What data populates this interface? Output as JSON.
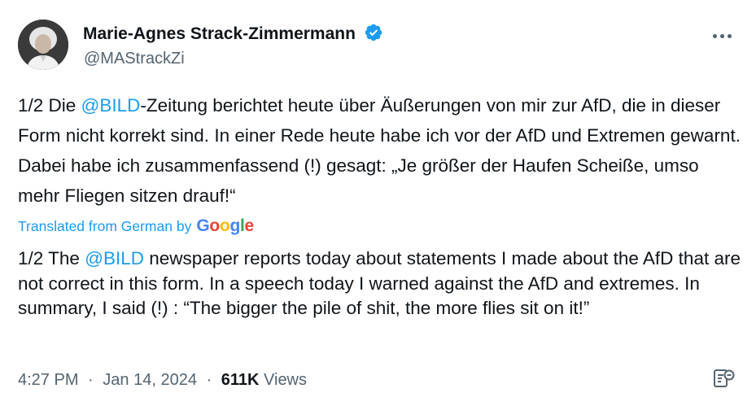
{
  "author": {
    "name": "Marie-Agnes Strack-Zimmermann",
    "handle": "@MAStrackZi",
    "verified": true
  },
  "tweet": {
    "original": {
      "part1": "1/2 Die ",
      "mention": "@BILD",
      "part2": "-Zeitung berichtet heute über Äußerungen von mir zur AfD, die in dieser Form nicht korrekt sind. In einer Rede heute habe ich vor der AfD und Extremen gewarnt. Dabei habe ich  zusammenfassend (!) gesagt: „Je größer der Haufen Scheiße, umso mehr Fliegen sitzen drauf!“"
    },
    "translation_note": "Translated from German by",
    "translator": "Google",
    "translated": {
      "part1": "1/2 The ",
      "mention": "@BILD",
      "part2": " newspaper reports today about statements I made about the AfD that are not correct in this form. In a speech today I warned against the AfD and extremes. In summary, I said (!) : “The bigger the pile of shit, the more flies sit on it!”"
    }
  },
  "meta": {
    "time": "4:27 PM",
    "separator": "·",
    "date": "Jan 14, 2024",
    "views_count": "611K",
    "views_label": "Views"
  },
  "colors": {
    "accent": "#1d9bf0",
    "text": "#0f1419",
    "secondary": "#536471"
  },
  "icons": {
    "verified": "verified-badge-icon",
    "more": "more-icon",
    "analytics": "analytics-icon"
  }
}
